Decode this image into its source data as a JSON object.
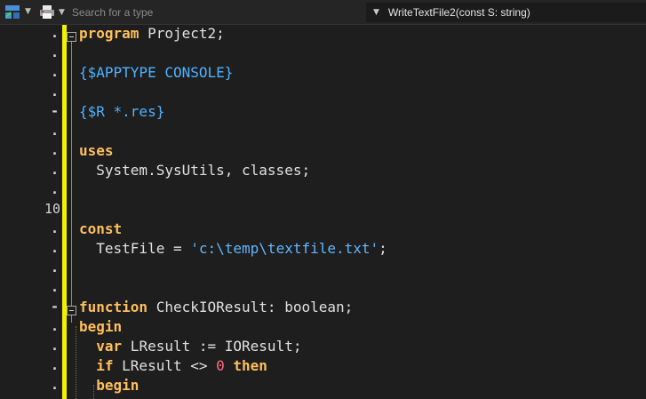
{
  "toolbar": {
    "search": {
      "placeholder": "Search for a type",
      "value": ""
    },
    "method_selector": {
      "value": "WriteTextFile2(const S: string)"
    },
    "icons": [
      "structure-view-icon",
      "printer-icon"
    ]
  },
  "gutter": {
    "lines": [
      ".",
      ".",
      ".",
      ".",
      "-",
      ".",
      ".",
      ".",
      ".",
      "10",
      ".",
      ".",
      ".",
      ".",
      "-",
      ".",
      ".",
      ".",
      "."
    ]
  },
  "code": {
    "lines": [
      [
        {
          "t": "program",
          "c": "kw"
        },
        {
          "t": " Project2;",
          "c": "txt"
        }
      ],
      [],
      [
        {
          "t": "{$APPTYPE CONSOLE}",
          "c": "dir"
        }
      ],
      [],
      [
        {
          "t": "{$R *.res}",
          "c": "dir"
        }
      ],
      [],
      [
        {
          "t": "uses",
          "c": "kw"
        }
      ],
      [
        {
          "t": "  System.SysUtils, classes;",
          "c": "txt"
        }
      ],
      [],
      [],
      [
        {
          "t": "const",
          "c": "kw"
        }
      ],
      [
        {
          "t": "  TestFile = ",
          "c": "txt"
        },
        {
          "t": "'c:\\temp\\textfile.txt'",
          "c": "str"
        },
        {
          "t": ";",
          "c": "txt"
        }
      ],
      [],
      [],
      [
        {
          "t": "function",
          "c": "kw"
        },
        {
          "t": " CheckIOResult: boolean;",
          "c": "txt"
        }
      ],
      [
        {
          "t": "begin",
          "c": "kw"
        }
      ],
      [
        {
          "t": "  ",
          "c": "txt"
        },
        {
          "t": "var",
          "c": "kw"
        },
        {
          "t": " LResult := IOResult;",
          "c": "txt"
        }
      ],
      [
        {
          "t": "  ",
          "c": "txt"
        },
        {
          "t": "if",
          "c": "kw"
        },
        {
          "t": " LResult <> ",
          "c": "txt"
        },
        {
          "t": "0",
          "c": "num"
        },
        {
          "t": " ",
          "c": "txt"
        },
        {
          "t": "then",
          "c": "kw"
        }
      ],
      [
        {
          "t": "  ",
          "c": "txt"
        },
        {
          "t": "begin",
          "c": "kw"
        }
      ]
    ]
  }
}
